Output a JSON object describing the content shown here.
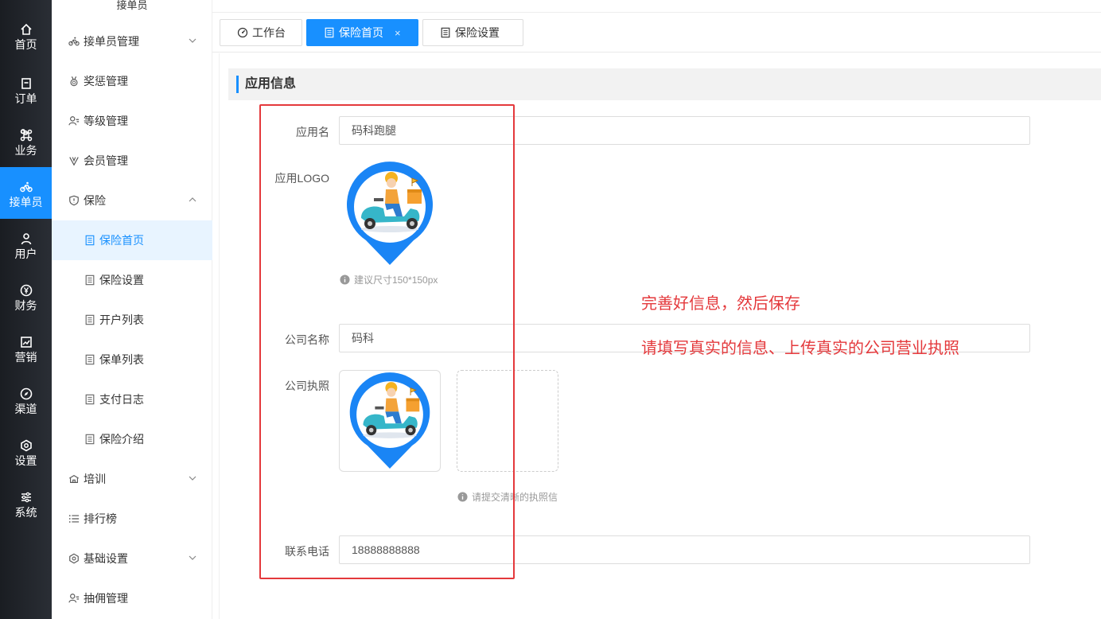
{
  "rail": [
    {
      "label": "首页",
      "icon": "home-icon"
    },
    {
      "label": "订单",
      "icon": "order-icon"
    },
    {
      "label": "业务",
      "icon": "command-icon"
    },
    {
      "label": "接单员",
      "icon": "bike-icon",
      "active": true
    },
    {
      "label": "用户",
      "icon": "user-icon"
    },
    {
      "label": "财务",
      "icon": "yen-icon"
    },
    {
      "label": "营销",
      "icon": "chart-icon"
    },
    {
      "label": "渠道",
      "icon": "compass-icon"
    },
    {
      "label": "设置",
      "icon": "hexagon-gear-icon"
    },
    {
      "label": "系统",
      "icon": "sliders-icon"
    }
  ],
  "sidebar": {
    "title": "接单员",
    "items": [
      {
        "label": "接单员管理",
        "icon": "bike-icon",
        "chevron": "down"
      },
      {
        "label": "奖惩管理",
        "icon": "medal-icon"
      },
      {
        "label": "等级管理",
        "icon": "user-level-icon"
      },
      {
        "label": "会员管理",
        "icon": "vip-icon"
      },
      {
        "label": "保险",
        "icon": "shield-icon",
        "chevron": "up"
      },
      {
        "label": "保险首页",
        "icon": "doc-icon",
        "sub": true,
        "active": true
      },
      {
        "label": "保险设置",
        "icon": "doc-icon",
        "sub": true
      },
      {
        "label": "开户列表",
        "icon": "doc-icon",
        "sub": true
      },
      {
        "label": "保单列表",
        "icon": "doc-icon",
        "sub": true
      },
      {
        "label": "支付日志",
        "icon": "doc-icon",
        "sub": true
      },
      {
        "label": "保险介绍",
        "icon": "doc-icon",
        "sub": true
      },
      {
        "label": "培训",
        "icon": "school-icon",
        "chevron": "down"
      },
      {
        "label": "排行榜",
        "icon": "list-icon"
      },
      {
        "label": "基础设置",
        "icon": "settings-icon",
        "chevron": "down"
      },
      {
        "label": "抽佣管理",
        "icon": "user-commission-icon"
      }
    ]
  },
  "tabs": [
    {
      "label": "工作台",
      "icon": "dashboard-icon"
    },
    {
      "label": "保险首页",
      "icon": "doc-icon",
      "active": true,
      "close": "×"
    },
    {
      "label": "保险设置",
      "icon": "doc-icon"
    }
  ],
  "section_title": "应用信息",
  "form": {
    "app_name_label": "应用名",
    "app_name_value": "码科跑腿",
    "app_logo_label": "应用LOGO",
    "logo_hint": "建议尺寸150*150px",
    "company_name_label": "公司名称",
    "company_name_value": "码科",
    "license_label": "公司执照",
    "license_hint": "请提交清晰的执照信",
    "phone_label": "联系电话",
    "phone_value": "18888888888"
  },
  "annotations": {
    "note1": "完善好信息，然后保存",
    "note2": "请填写真实的信息、上传真实的公司营业执照"
  },
  "colors": {
    "accent": "#1890ff",
    "annotation": "#e4393c",
    "rail": "#1f2329"
  }
}
